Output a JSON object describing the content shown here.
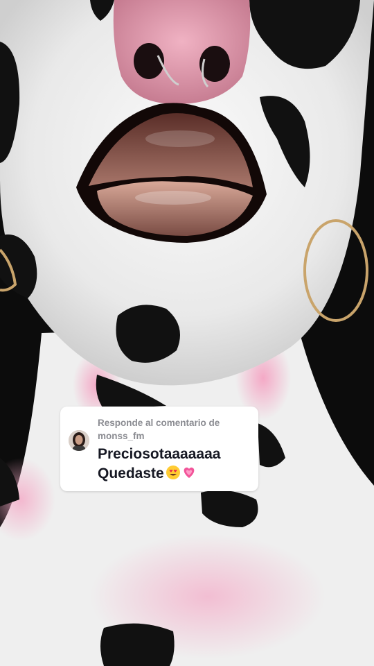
{
  "reply_card": {
    "label": "Responde al comentario de",
    "username": "monss_fm",
    "comment_line1": "Preciosotaaaaaaa",
    "comment_line2": "Quedaste",
    "emojis": [
      "heart-eyes-emoji",
      "growing-heart-emoji"
    ]
  },
  "video": {
    "subject": "cow-print-makeup-lips-closeup"
  },
  "colors": {
    "card_bg": "#ffffff",
    "header_text": "#8a8b91",
    "comment_text": "#161823",
    "skin_white": "#f2f2f2",
    "spot_black": "#111111",
    "nose_pink": "#d98fa4"
  }
}
